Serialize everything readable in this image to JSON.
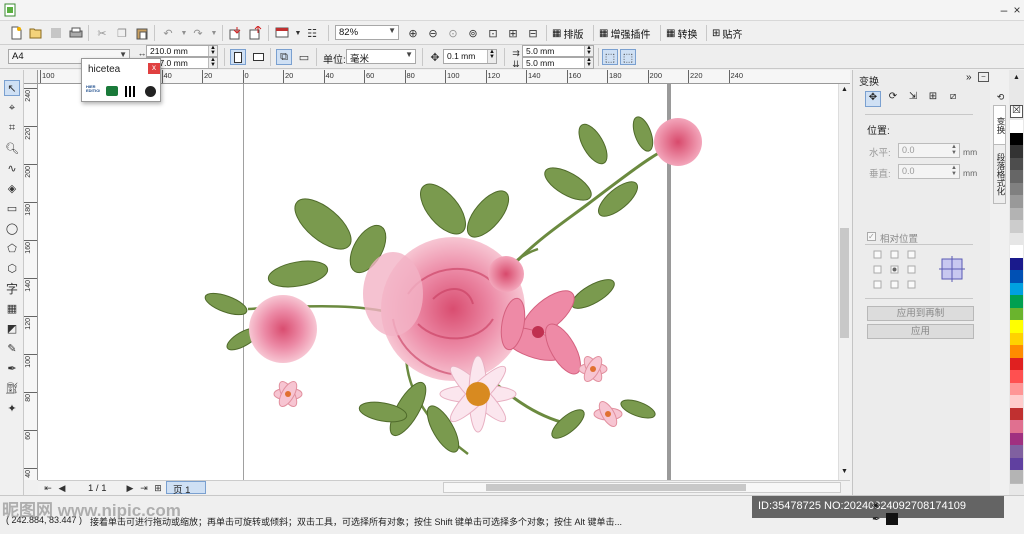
{
  "toolbar_main": {
    "zoom_value": "82%",
    "btn_layout": "排版",
    "btn_plugins": "增强插件",
    "btn_convert": "转换",
    "btn_align": "贴齐"
  },
  "toolbar_prop": {
    "page_size": "A4",
    "width": "210.0 mm",
    "height": "297.0 mm",
    "unit_label": "单位:",
    "unit_value": "毫米",
    "nudge": "0.1 mm",
    "dup_x": "5.0 mm",
    "dup_y": "5.0 mm"
  },
  "hruler_ticks": [
    "100",
    "80",
    "60",
    "40",
    "20",
    "0",
    "20",
    "40",
    "60",
    "80",
    "100",
    "120",
    "140",
    "160",
    "180",
    "200",
    "220",
    "240"
  ],
  "vruler_ticks": [
    "240",
    "220",
    "200",
    "180",
    "160",
    "140",
    "120",
    "100",
    "80",
    "60",
    "40",
    "20"
  ],
  "dialog": {
    "title": "hicetea",
    "close": "x",
    "icon1": "HIER EDITION"
  },
  "panel": {
    "title": "变换",
    "position_label": "位置:",
    "h_label": "水平:",
    "h_value": "0.0",
    "v_label": "垂直:",
    "v_value": "0.0",
    "unit": "mm",
    "relative_label": "相对位置",
    "apply_copy": "应用到再制",
    "apply": "应用"
  },
  "side_tabs": {
    "tab1": "变换",
    "tab2": "段落格式化"
  },
  "pages": {
    "counter": "1 / 1",
    "tab": "页 1"
  },
  "status": {
    "coords": "( 242.884, 83.447 )",
    "hint": "接着单击可进行拖动或缩放；再单击可旋转或倾斜；双击工具，可选择所有对象；按住 Shift 键单击可选择多个对象；按住 Alt 键单击...",
    "watermark_id": "ID:35478725 NO:20240824092708174109",
    "watermark_site": "昵图网 www.nipic.com"
  },
  "palette_colors": [
    "#ffffff",
    "#000000",
    "#333333",
    "#4d4d4d",
    "#666666",
    "#808080",
    "#999999",
    "#b3b3b3",
    "#cccccc",
    "#e6e6e6",
    "#ffffff",
    "#1a1a8c",
    "#0050b4",
    "#00a0e0",
    "#00a050",
    "#6ab42d",
    "#ffff00",
    "#ffd200",
    "#ff8c00",
    "#e02020",
    "#ff5050",
    "#ff9696",
    "#ffcccc",
    "#c03030",
    "#e07090",
    "#a03080",
    "#8060a0",
    "#6040a0",
    "#b4b4b4"
  ]
}
